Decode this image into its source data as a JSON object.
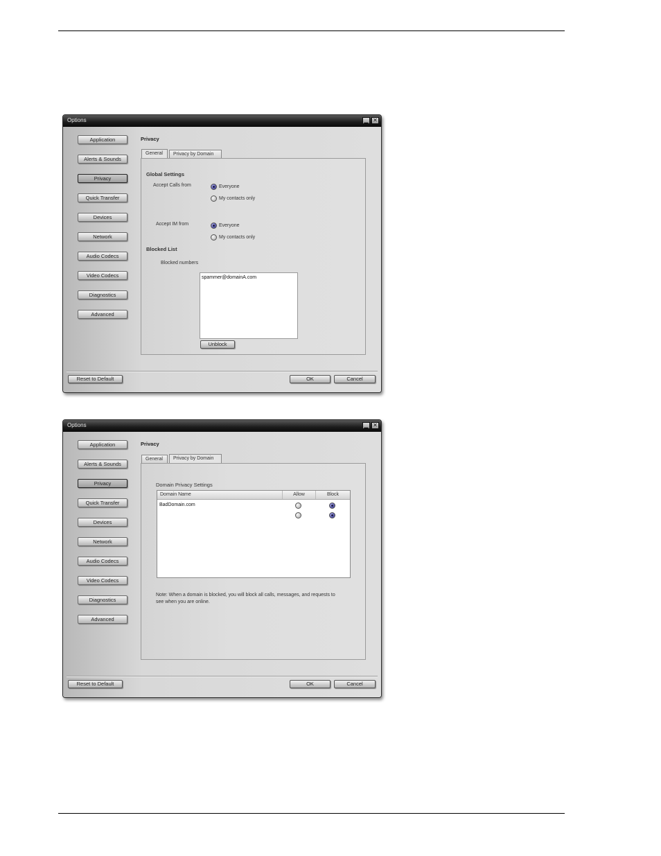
{
  "window1": {
    "title": "Options",
    "nav": [
      "Application",
      "Alerts & Sounds",
      "Privacy",
      "Quick Transfer",
      "Devices",
      "Network",
      "Audio Codecs",
      "Video Codecs",
      "Diagnostics",
      "Advanced"
    ],
    "active_nav": "Privacy",
    "section_title": "Privacy",
    "tabs": [
      "General",
      "Privacy by Domain"
    ],
    "active_tab": "General",
    "global_settings": "Global Settings",
    "accept_calls_label": "Accept Calls from",
    "accept_im_label": "Accept IM from",
    "option_everyone": "Everyone",
    "option_contacts": "My contacts only",
    "accept_calls_selected": "Everyone",
    "accept_im_selected": "Everyone",
    "blocked_list": "Blocked List",
    "blocked_numbers_label": "Blocked numbers",
    "blocked_entries": [
      "spammer@domainA.com"
    ],
    "unblock_button": "Unblock",
    "reset_button": "Reset to Default",
    "ok_button": "OK",
    "cancel_button": "Cancel"
  },
  "window2": {
    "title": "Options",
    "nav": [
      "Application",
      "Alerts & Sounds",
      "Privacy",
      "Quick Transfer",
      "Devices",
      "Network",
      "Audio Codecs",
      "Video Codecs",
      "Diagnostics",
      "Advanced"
    ],
    "active_nav": "Privacy",
    "section_title": "Privacy",
    "tabs": [
      "General",
      "Privacy by Domain"
    ],
    "active_tab": "Privacy by Domain",
    "domain_settings_title": "Domain Privacy Settings",
    "columns": [
      "Domain Name",
      "Allow",
      "Block"
    ],
    "rows": [
      {
        "domain": "BadDomain.com",
        "selected": "Block"
      },
      {
        "domain": "",
        "selected": "Block"
      }
    ],
    "note": "Note:  When a domain is blocked, you will block all calls, messages, and requests to see when you are online.",
    "reset_button": "Reset to Default",
    "ok_button": "OK",
    "cancel_button": "Cancel"
  },
  "colors": {
    "titlebar": "#1c1c1c",
    "window_bg": "#d8d8d8",
    "radio_selected": "#5a5ab0"
  }
}
